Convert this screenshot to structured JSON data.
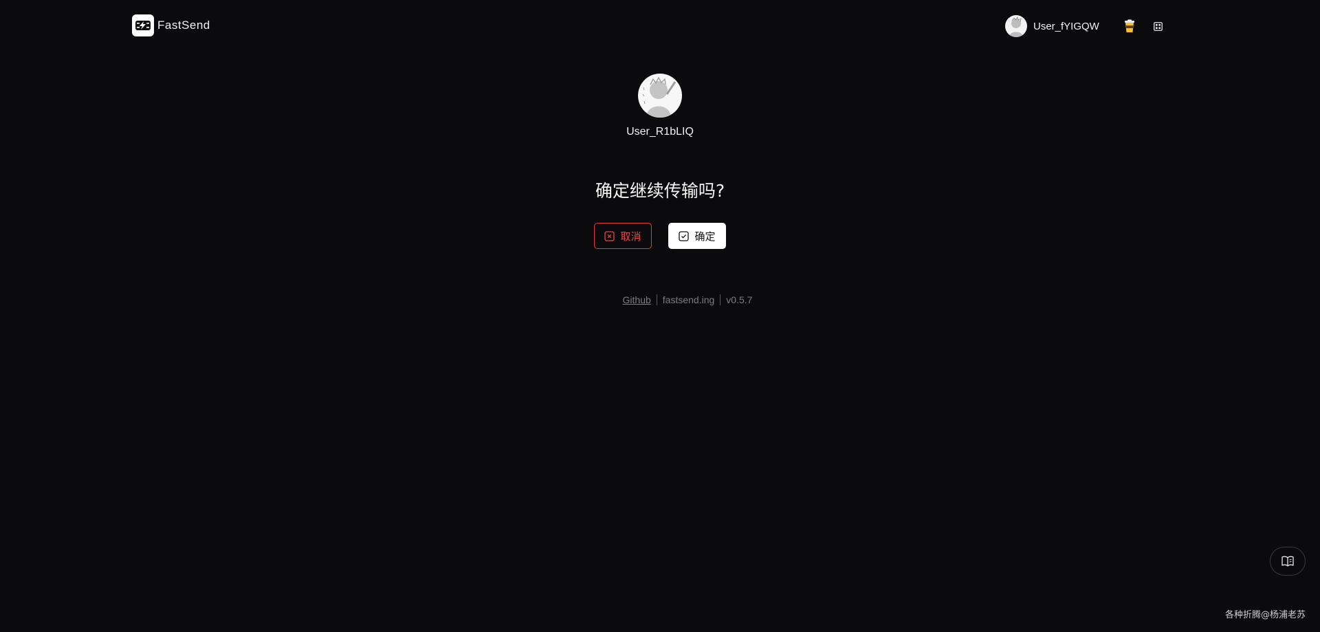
{
  "header": {
    "app_name": "FastSend",
    "username": "User_fYIGQW"
  },
  "peer": {
    "username": "User_R1bLIQ"
  },
  "dialog": {
    "question": "确定继续传输吗?",
    "cancel_label": "取消",
    "confirm_label": "确定"
  },
  "footer": {
    "github_label": "Github",
    "site_label": "fastsend.ing",
    "version": "v0.5.7"
  },
  "watermark": "各种折腾@杨浦老苏",
  "colors": {
    "background": "#0b0b0d",
    "cancel_accent": "#e23b3b",
    "confirm_background": "#ffffff"
  },
  "icons": {
    "logo": "fastsend-logo-icon",
    "coffee": "coffee-cup-icon",
    "qr": "qr-code-icon",
    "cancel": "square-x-icon",
    "confirm": "square-check-icon",
    "guide": "book-icon"
  }
}
